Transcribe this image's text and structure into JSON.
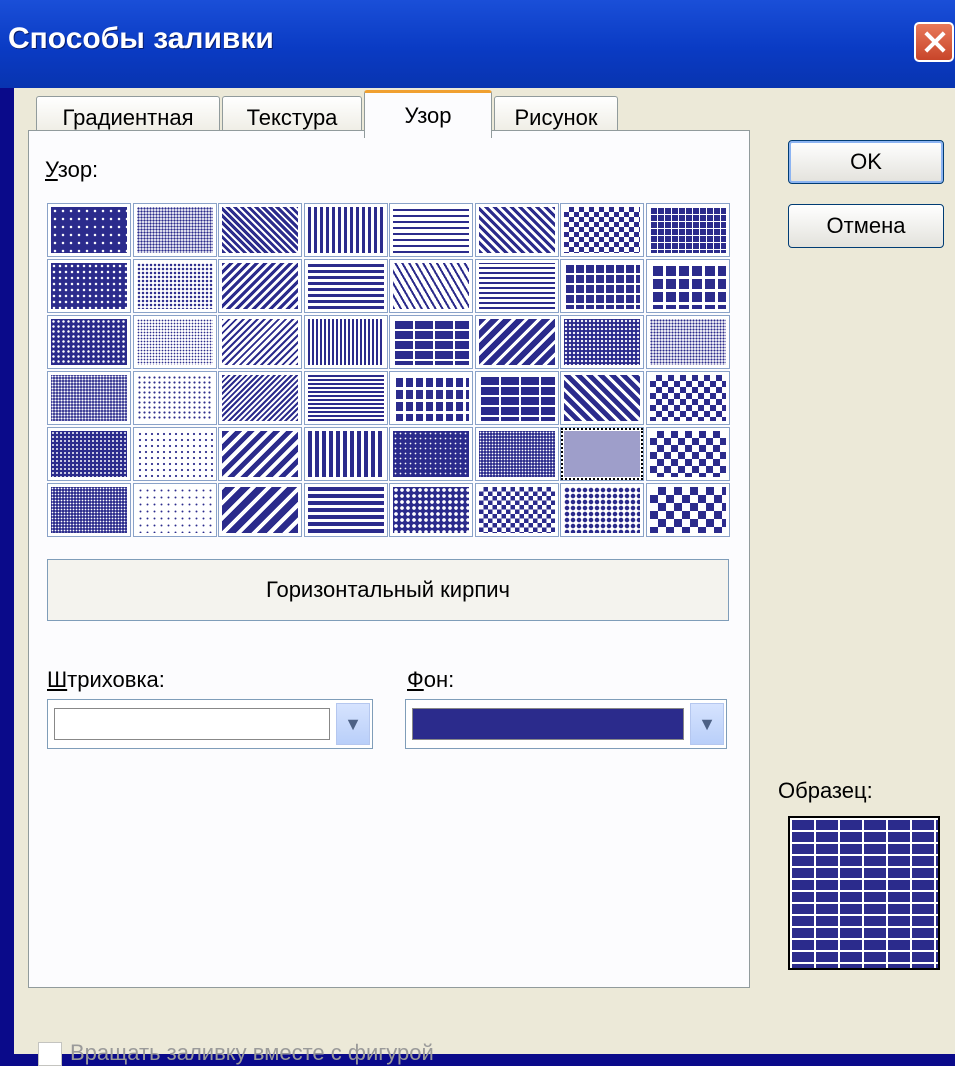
{
  "window": {
    "title": "Способы заливки"
  },
  "tabs": [
    {
      "label": "Градиентная",
      "active": false
    },
    {
      "label": "Текстура",
      "active": false
    },
    {
      "label": "Узор",
      "active": true
    },
    {
      "label": "Рисунок",
      "active": false
    }
  ],
  "pattern_section": {
    "label_accel": "У",
    "label_rest": "зор:",
    "selected_name": "Горизонтальный кирпич",
    "rows": 6,
    "columns": 8,
    "selected_row": 4,
    "selected_column": 6
  },
  "foreground": {
    "label_accel": "Ш",
    "label_rest": "триховка:",
    "color": "#ffffff"
  },
  "background": {
    "label_accel": "Ф",
    "label_rest": "он:",
    "color": "#2b2b8c"
  },
  "buttons": {
    "ok": "OK",
    "cancel": "Отмена"
  },
  "sample": {
    "label": "Образец:"
  },
  "rotate_option": {
    "label": "Вращать заливку вместе с фигурой",
    "checked": false,
    "enabled": false
  },
  "colors": {
    "pattern": "#2b2b8c",
    "titlebar": "#0a3bc4",
    "dialog": "#ece9d8",
    "desktop": "#0a0a8a"
  }
}
